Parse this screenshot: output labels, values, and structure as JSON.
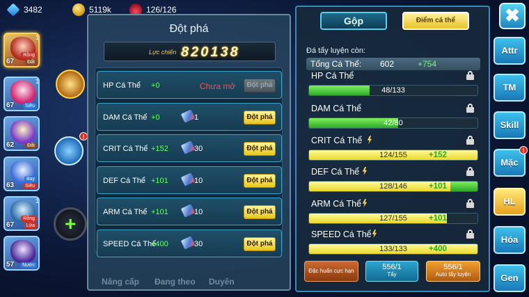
{
  "resources": {
    "gems": "3482",
    "gold": "5119k",
    "stamina": "126/126"
  },
  "pets": [
    {
      "level": "67",
      "tag": "Rồng",
      "tag2": "Đất",
      "num": "1",
      "selected": true
    },
    {
      "level": "67",
      "tag": "Siêu",
      "num": "1"
    },
    {
      "level": "62",
      "tag": "Đất",
      "num": ""
    },
    {
      "level": "63",
      "tag": "Bay",
      "tag2": "Siêu",
      "num": ""
    },
    {
      "level": "67",
      "tag": "Rồng",
      "tag2": "Lửa",
      "num": "1"
    },
    {
      "level": "57",
      "tag": "Nước",
      "num": ""
    }
  ],
  "breakthrough": {
    "title": "Đột phá",
    "power_label": "Lực chiến",
    "power_value": "820138",
    "rows": [
      {
        "name": "HP Cá Thể",
        "plus": "+0",
        "status": "Chưa mở",
        "button": "Đột phá",
        "enabled": false
      },
      {
        "name": "DAM Cá Thể",
        "plus": "+0",
        "count": "1",
        "button": "Đột phá",
        "enabled": true
      },
      {
        "name": "CRIT Cá Thể",
        "plus": "+152",
        "count": "30",
        "button": "Đột phá",
        "enabled": true
      },
      {
        "name": "DEF Cá Thể",
        "plus": "+101",
        "count": "10",
        "button": "Đột phá",
        "enabled": true
      },
      {
        "name": "ARM Cá Thể",
        "plus": "+101",
        "count": "10",
        "button": "Đột phá",
        "enabled": true
      },
      {
        "name": "SPEED Cá Thể",
        "plus": "+400",
        "count": "30",
        "button": "Đột phá",
        "enabled": true
      }
    ],
    "bottom_tabs": [
      "Nâng cấp",
      "Đang theo",
      "Duyên"
    ]
  },
  "training": {
    "tab_merge": "Gộp",
    "tab_points": "Điểm cá thể",
    "remaining_label": "Đá tẩy luyện còn:",
    "total_label": "Tổng Cá Thể:",
    "total_value": "602",
    "total_gain": "+754",
    "stats": [
      {
        "name": "HP Cá Thể",
        "text": "48/133",
        "gain": "",
        "progress": 0.36,
        "bar": "green",
        "bolt": false
      },
      {
        "name": "DAM Cá Thể",
        "text": "42/80",
        "gain": "",
        "progress": 0.525,
        "bar": "green",
        "bolt": false
      },
      {
        "name": "CRIT Cá Thể",
        "text": "124/155",
        "gain": "+152",
        "progress": 1.0,
        "bar": "yellow",
        "bolt": true
      },
      {
        "name": "DEF Cá Thể",
        "text": "128/146",
        "gain": "+101",
        "progress": 0.877,
        "bar": "mixed",
        "bolt": true
      },
      {
        "name": "ARM Cá Thể",
        "text": "127/155",
        "gain": "+101",
        "progress": 0.82,
        "bar": "yellow",
        "bolt": true
      },
      {
        "name": "SPEED Cá Thể",
        "text": "133/133",
        "gain": "+400",
        "progress": 1.0,
        "bar": "yellow",
        "bolt": true
      }
    ],
    "btn_special": "Đặc huấn cực hạn",
    "btn_wash_count": "556/1",
    "btn_wash": "Tẩy",
    "btn_auto_count": "556/1",
    "btn_auto": "Auto tẩy luyện"
  },
  "nav": {
    "close": "✖",
    "items": [
      "Attr",
      "TM",
      "Skill",
      "Mặc",
      "HL",
      "Hóa",
      "Gen"
    ],
    "active": "HL"
  },
  "colors": {
    "accent_cyan": "#3dc0ec",
    "gold": "#e7c61a",
    "gain_green": "#6cff6c",
    "locked_red": "#ff4d4d"
  }
}
